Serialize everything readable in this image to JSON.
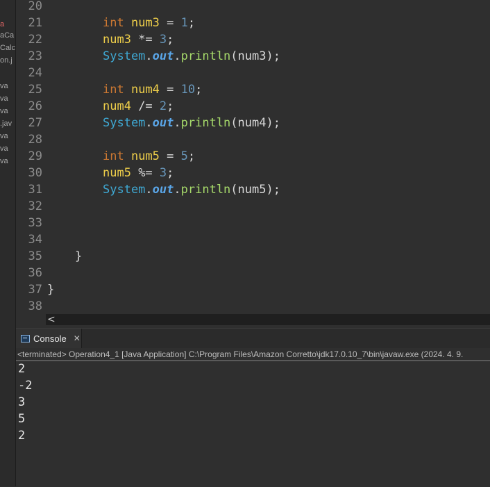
{
  "explorer": {
    "fragments": [
      "a",
      "aCa",
      "Calc",
      "on.j",
      "va",
      "va",
      "va",
      ".jav",
      "va",
      "va",
      "va"
    ]
  },
  "editor": {
    "lines": [
      {
        "n": "20",
        "tokens": []
      },
      {
        "n": "21",
        "tokens": [
          [
            "kw",
            "int"
          ],
          [
            "pl",
            " "
          ],
          [
            "var",
            "num3"
          ],
          [
            "pl",
            " = "
          ],
          [
            "num",
            "1"
          ],
          [
            "pl",
            ";"
          ]
        ]
      },
      {
        "n": "22",
        "tokens": [
          [
            "var",
            "num3"
          ],
          [
            "pl",
            " *= "
          ],
          [
            "num",
            "3"
          ],
          [
            "pl",
            ";"
          ]
        ]
      },
      {
        "n": "23",
        "tokens": [
          [
            "cls",
            "System"
          ],
          [
            "pl",
            "."
          ],
          [
            "fld",
            "out"
          ],
          [
            "pl",
            "."
          ],
          [
            "mth",
            "println"
          ],
          [
            "pl",
            "(num3);"
          ]
        ]
      },
      {
        "n": "24",
        "tokens": []
      },
      {
        "n": "25",
        "tokens": [
          [
            "kw",
            "int"
          ],
          [
            "pl",
            " "
          ],
          [
            "var",
            "num4"
          ],
          [
            "pl",
            " = "
          ],
          [
            "num",
            "10"
          ],
          [
            "pl",
            ";"
          ]
        ]
      },
      {
        "n": "26",
        "tokens": [
          [
            "var",
            "num4"
          ],
          [
            "pl",
            " /= "
          ],
          [
            "num",
            "2"
          ],
          [
            "pl",
            ";"
          ]
        ]
      },
      {
        "n": "27",
        "tokens": [
          [
            "cls",
            "System"
          ],
          [
            "pl",
            "."
          ],
          [
            "fld",
            "out"
          ],
          [
            "pl",
            "."
          ],
          [
            "mth",
            "println"
          ],
          [
            "pl",
            "(num4);"
          ]
        ]
      },
      {
        "n": "28",
        "tokens": []
      },
      {
        "n": "29",
        "tokens": [
          [
            "kw",
            "int"
          ],
          [
            "pl",
            " "
          ],
          [
            "var",
            "num5"
          ],
          [
            "pl",
            " = "
          ],
          [
            "num",
            "5"
          ],
          [
            "pl",
            ";"
          ]
        ]
      },
      {
        "n": "30",
        "tokens": [
          [
            "var",
            "num5"
          ],
          [
            "pl",
            " %= "
          ],
          [
            "num",
            "3"
          ],
          [
            "pl",
            ";"
          ]
        ]
      },
      {
        "n": "31",
        "tokens": [
          [
            "cls",
            "System"
          ],
          [
            "pl",
            "."
          ],
          [
            "fld",
            "out"
          ],
          [
            "pl",
            "."
          ],
          [
            "mth",
            "println"
          ],
          [
            "pl",
            "(num5);"
          ]
        ]
      },
      {
        "n": "32",
        "tokens": []
      },
      {
        "n": "33",
        "tokens": []
      },
      {
        "n": "34",
        "tokens": []
      },
      {
        "n": "35",
        "tokens": [
          [
            "pl",
            "}"
          ]
        ]
      },
      {
        "n": "36",
        "tokens": []
      },
      {
        "n": "37",
        "tokens": [
          [
            "pl",
            "}"
          ]
        ]
      },
      {
        "n": "38",
        "tokens": []
      }
    ],
    "indent": [
      0,
      2,
      2,
      2,
      0,
      2,
      2,
      2,
      0,
      2,
      2,
      2,
      0,
      0,
      0,
      1,
      0,
      0,
      0
    ],
    "scroll_left_glyph": "<"
  },
  "console": {
    "tab_label": "Console",
    "close_glyph": "✕",
    "status": "<terminated> Operation4_1 [Java Application] C:\\Program Files\\Amazon Corretto\\jdk17.0.10_7\\bin\\javaw.exe  (2024. 4. 9.",
    "output": [
      "2",
      "-2",
      "3",
      "5",
      "2"
    ]
  }
}
